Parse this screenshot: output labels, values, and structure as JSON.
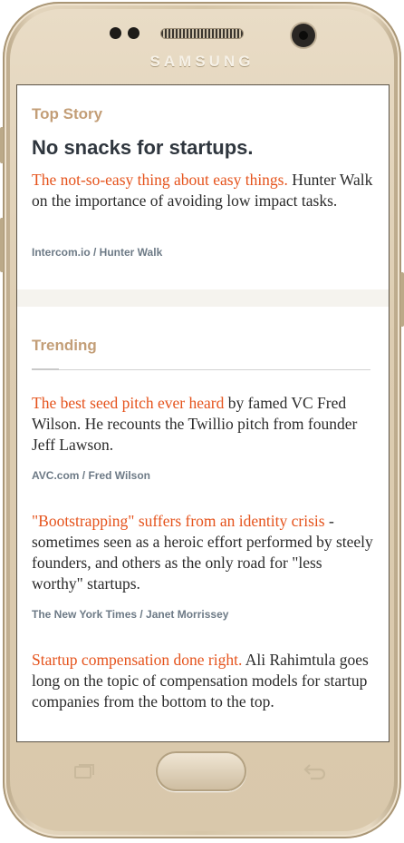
{
  "device": {
    "brand": "SAMSUNG"
  },
  "top_story": {
    "section_title": "Top Story",
    "headline": "No snacks for startups.",
    "link_text": "The not-so-easy thing about easy things.",
    "body": " Hunter Walk on the importance of avoiding low impact tasks.",
    "source": "Intercom.io / Hunter Walk"
  },
  "trending": {
    "section_title": "Trending",
    "items": [
      {
        "link_text": "The best seed pitch ever heard",
        "body": " by famed VC Fred Wilson. He recounts the Twillio pitch from founder Jeff Lawson.",
        "source": "AVC.com / Fred Wilson"
      },
      {
        "link_text": "\"Bootstrapping\" suffers from an identity crisis",
        "body": " - sometimes seen as a heroic effort performed by steely founders, and others as the only road for \"less worthy\" startups.",
        "source": "The New York Times / Janet Morrissey"
      },
      {
        "link_text": "Startup compensation done right.",
        "body": " Ali Rahimtula goes long on the topic of compensation models for startup companies from the bottom to the top."
      }
    ]
  },
  "colors": {
    "accent_link": "#e5531c",
    "section_title": "#c39e77",
    "headline": "#2f363e",
    "source": "#6d7a86"
  },
  "icons": [
    "recent-apps-icon",
    "home-button",
    "back-icon"
  ]
}
